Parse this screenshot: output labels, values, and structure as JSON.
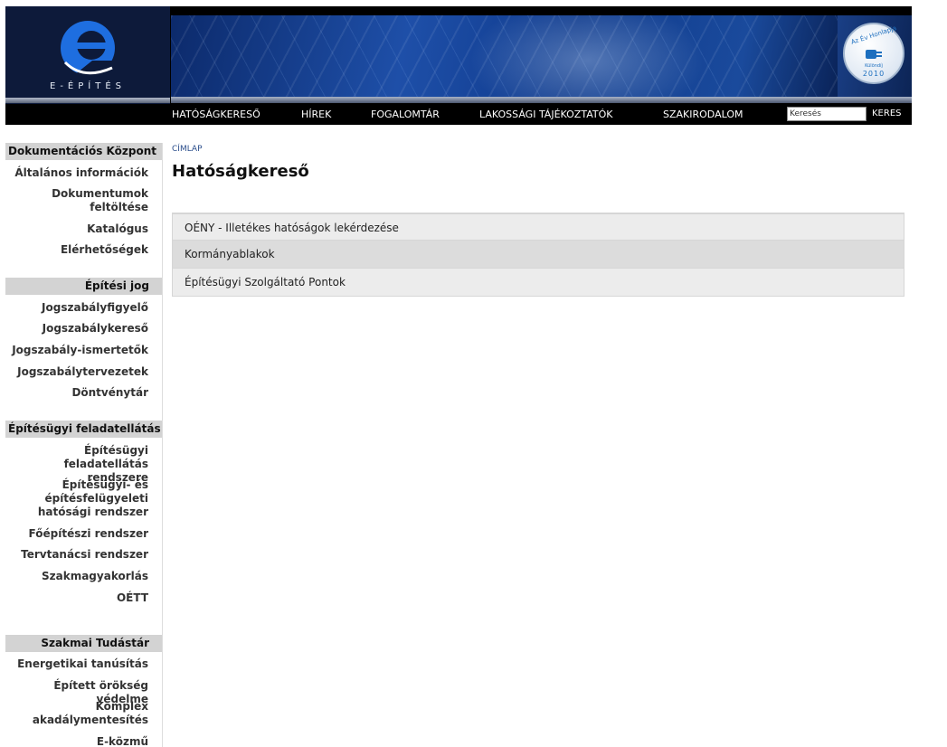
{
  "brand": {
    "logo_text": "E-ÉPÍTÉS",
    "award_top": "Az Év Honlapja",
    "award_sub": "Különdíj",
    "award_year": "2010",
    "logo_color": "#1e6ee0"
  },
  "nav": {
    "items": [
      {
        "label": "HATÓSÁGKERESŐ"
      },
      {
        "label": "HÍREK"
      },
      {
        "label": "FOGALOMTÁR"
      },
      {
        "label": "LAKOSSÁGI TÁJÉKOZTATÓK"
      },
      {
        "label": "SZAKIRODALOM"
      }
    ],
    "search_value": "Keresés",
    "search_button": "KERES"
  },
  "sidebar": {
    "sections": [
      {
        "title": "Dokumentációs Központ",
        "items": [
          "Általános információk",
          "Dokumentumok feltöltése",
          "Katalógus",
          "Elérhetőségek"
        ]
      },
      {
        "title": "Építési jog",
        "items": [
          "Jogszabályfigyelő",
          "Jogszabálykereső",
          "Jogszabály-ismertetők",
          "Jogszabálytervezetek",
          "Döntvénytár"
        ]
      },
      {
        "title": "Építésügyi feladatellátás",
        "items": [
          "Építésügyi feladatellátás rendszere",
          "Építésügyi- és építésfelügyeleti hatósági rendszer",
          "Főépítészi rendszer",
          "Tervtanácsi rendszer",
          "Szakmagyakorlás",
          "OÉTT"
        ]
      },
      {
        "title": "Szakmai Tudástár",
        "items": [
          "Energetikai tanúsítás",
          "Épített örökség védelme",
          "Komplex akadálymentesítés",
          "E-közmű"
        ]
      }
    ]
  },
  "main": {
    "breadcrumb": "CÍMLAP",
    "title": "Hatóságkereső",
    "links": [
      {
        "label": "OÉNY - Illetékes hatóságok lekérdezése"
      },
      {
        "label": "Kormányablakok"
      },
      {
        "label": "Építésügyi Szolgáltató Pontok"
      }
    ]
  }
}
